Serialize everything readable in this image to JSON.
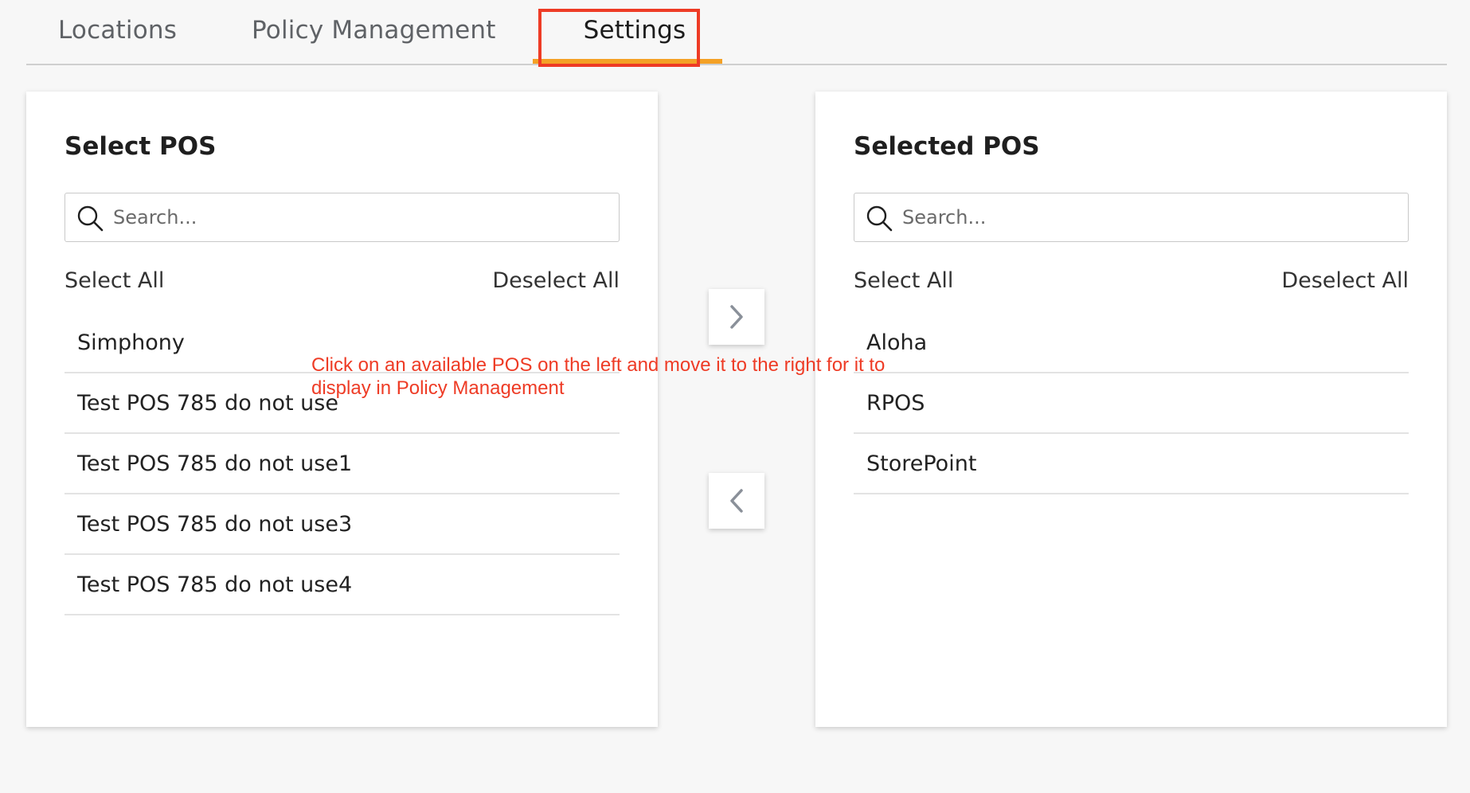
{
  "tabs": {
    "locations": "Locations",
    "policy_management": "Policy Management",
    "settings": "Settings",
    "active": "Settings"
  },
  "left_panel": {
    "title": "Select POS",
    "search_placeholder": "Search...",
    "select_all": "Select All",
    "deselect_all": "Deselect All",
    "items": [
      "Simphony",
      "Test POS 785 do not use",
      "Test POS 785 do not use1",
      "Test POS 785 do not use3",
      "Test POS 785 do not use4"
    ]
  },
  "right_panel": {
    "title": "Selected POS",
    "search_placeholder": "Search...",
    "select_all": "Select All",
    "deselect_all": "Deselect All",
    "items": [
      "Aloha",
      "RPOS",
      "StorePoint"
    ]
  },
  "annotation": "Click on an available POS on the left and move it to the right for it to display in Policy Management",
  "icons": {
    "search": "search-icon",
    "move_right": "chevron-right-icon",
    "move_left": "chevron-left-icon"
  },
  "colors": {
    "active_tab_underline": "#f4a126",
    "annotation": "#ee3b25",
    "highlight_box": "#ee3b25"
  }
}
